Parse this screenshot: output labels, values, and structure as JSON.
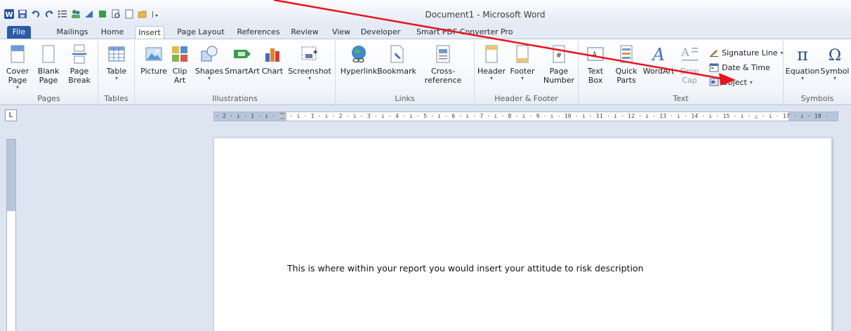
{
  "window": {
    "title": "Document1 - Microsoft Word"
  },
  "tabs": [
    {
      "label": "File"
    },
    {
      "label": "Mailings"
    },
    {
      "label": "Home"
    },
    {
      "label": "Insert"
    },
    {
      "label": "Page Layout"
    },
    {
      "label": "References"
    },
    {
      "label": "Review"
    },
    {
      "label": "View"
    },
    {
      "label": "Developer"
    },
    {
      "label": "Smart PDF Converter Pro"
    }
  ],
  "ribbon": {
    "pages": {
      "label": "Pages",
      "cover_page": "Cover Page",
      "blank_page": "Blank Page",
      "page_break": "Page Break"
    },
    "tables": {
      "label": "Tables",
      "table": "Table"
    },
    "illustrations": {
      "label": "Illustrations",
      "picture": "Picture",
      "clip_art": "Clip Art",
      "shapes": "Shapes",
      "smartart": "SmartArt",
      "chart": "Chart",
      "screenshot": "Screenshot"
    },
    "links": {
      "label": "Links",
      "hyperlink": "Hyperlink",
      "bookmark": "Bookmark",
      "cross_reference": "Cross-reference"
    },
    "header_footer": {
      "label": "Header & Footer",
      "header": "Header",
      "footer": "Footer",
      "page_number": "Page Number"
    },
    "text": {
      "label": "Text",
      "text_box": "Text Box",
      "quick_parts": "Quick Parts",
      "wordart": "WordArt",
      "drop_cap": "Drop Cap",
      "signature_line": "Signature Line",
      "date_time": "Date & Time",
      "object": "Object"
    },
    "symbols": {
      "label": "Symbols",
      "equation": "Equation",
      "symbol": "Symbol"
    }
  },
  "ruler": {
    "tab_selector": "L",
    "horizontal": "· 2 · ı · 1 · ı · ⌛ · ı · 1 · ı · 2 · ı · 3 · ı · 4 · ı · 5 · ı · 6 · ı · 7 · ı · 8 · ı · 9 · ı · 10 · ı · 11 · ı · 12 · ı · 13 · ı · 14 · ı · 15 · ı · △ · ı · 17 · ı · 18 ·"
  },
  "document": {
    "body_text": "This is where within your report you would insert your attitude to risk description"
  },
  "colors": {
    "file_tab": "#2a5aa8",
    "ribbon_bg": "#f2f5fa",
    "workspace_bg": "#dde5f0",
    "annotation_arrow": "#e8141a"
  }
}
